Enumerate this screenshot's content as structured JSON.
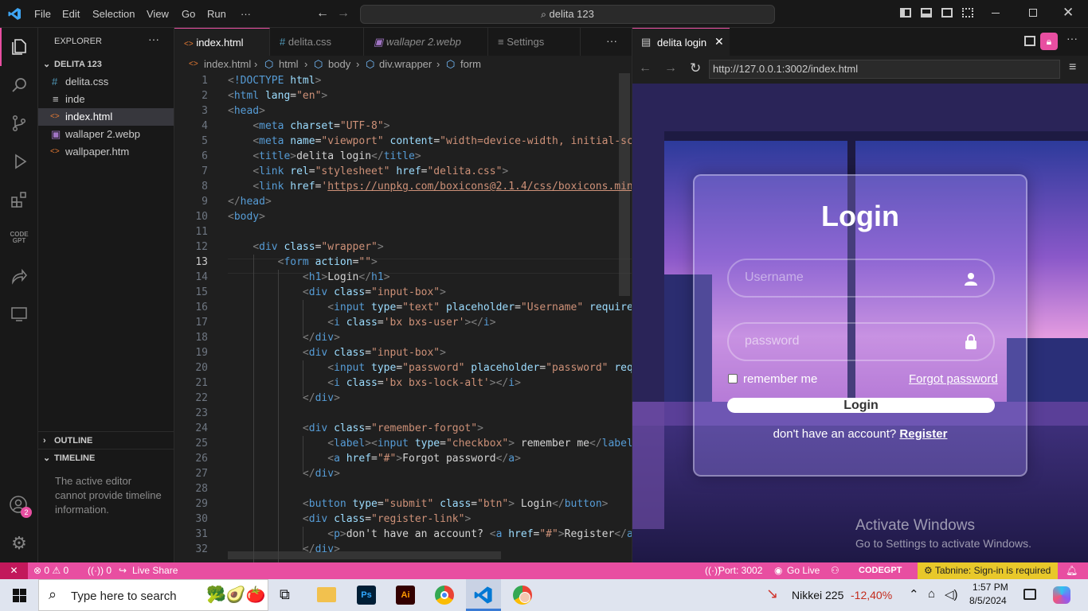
{
  "menu": {
    "file": "File",
    "edit": "Edit",
    "selection": "Selection",
    "view": "View",
    "go": "Go",
    "run": "Run",
    "more": "···",
    "search": "delita 123"
  },
  "explorer": {
    "title": "EXPLORER",
    "more": "···",
    "folder": "DELITA 123",
    "files": [
      {
        "icon": "#",
        "name": "delita.css"
      },
      {
        "icon": "≡",
        "name": "inde"
      },
      {
        "icon": "<>",
        "name": "index.html"
      },
      {
        "icon": "▣",
        "name": "wallaper 2.webp"
      },
      {
        "icon": "<>",
        "name": "wallpaper.htm"
      }
    ],
    "outline": "OUTLINE",
    "timeline": "TIMELINE",
    "timeline_msg": "The active editor cannot provide timeline information."
  },
  "tabs": [
    {
      "icon": "<>",
      "label": "index.html"
    },
    {
      "icon": "#",
      "label": "delita.css"
    },
    {
      "icon": "▣",
      "label": "wallaper 2.webp"
    },
    {
      "icon": "≡",
      "label": "Settings"
    }
  ],
  "tabs_more": "···",
  "breadcrumb": [
    "index.html",
    "html",
    "body",
    "div.wrapper",
    "form"
  ],
  "code_lines": [
    "1",
    "2",
    "3",
    "4",
    "5",
    "6",
    "7",
    "8",
    "9",
    "10",
    "11",
    "12",
    "13",
    "14",
    "15",
    "16",
    "17",
    "18",
    "19",
    "20",
    "21",
    "22",
    "23",
    "24",
    "25",
    "26",
    "27",
    "28",
    "29",
    "30",
    "31",
    "32"
  ],
  "browser": {
    "tab": "delita login",
    "url": "http://127.0.0.1:3002/index.html",
    "login_title": "Login",
    "username_placeholder": "Username",
    "password_placeholder": "password",
    "remember": "remember me",
    "forgot": "Forgot password",
    "login_button": "Login",
    "no_account": "don't have an account?",
    "register": "Register",
    "activate_title": "Activate Windows",
    "activate_sub": "Go to Settings to activate Windows."
  },
  "status": {
    "errors": "⊗ 0 ⚠ 0",
    "ports": "((·)) 0",
    "live_share": "Live Share",
    "port": "Port: 3002",
    "go_live": "Go Live",
    "codegpt": "CODEGPT",
    "tabnine": "Tabnine: Sign-in is required"
  },
  "taskbar": {
    "search": "Type here to search",
    "stock": "Nikkei 225",
    "stock_change": "-12,40%",
    "time": "1:57 PM",
    "date": "8/5/2024"
  },
  "colors": {
    "accent": "#e84ea1",
    "tag": "#569cd6",
    "attr": "#9cdcfe",
    "string": "#ce9178",
    "badge": "#e84ea1"
  }
}
